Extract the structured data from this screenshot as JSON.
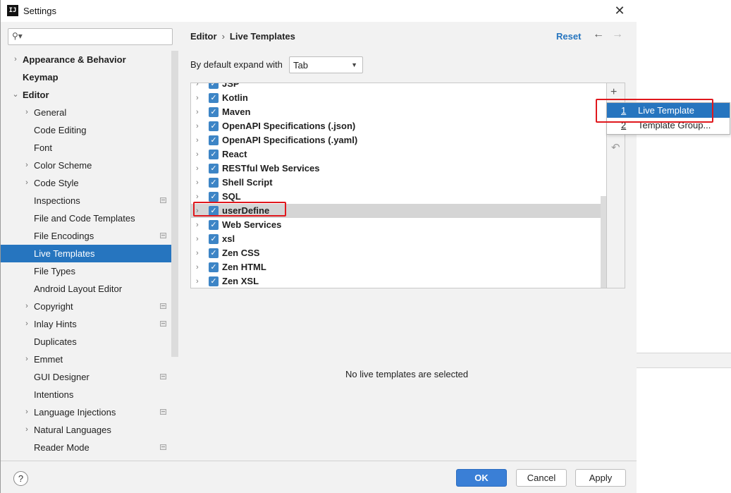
{
  "window": {
    "title": "Settings",
    "app_icon_text": "IJ"
  },
  "search": {
    "placeholder": ""
  },
  "sidebar": {
    "items": [
      {
        "label": "Appearance & Behavior",
        "bold": true,
        "level": 0,
        "chevron": "›"
      },
      {
        "label": "Keymap",
        "bold": true,
        "level": 0,
        "chevron": ""
      },
      {
        "label": "Editor",
        "bold": true,
        "level": 0,
        "chevron": "⌄"
      },
      {
        "label": "General",
        "level": 1,
        "chevron": "›"
      },
      {
        "label": "Code Editing",
        "level": 1,
        "chevron": ""
      },
      {
        "label": "Font",
        "level": 1,
        "chevron": ""
      },
      {
        "label": "Color Scheme",
        "level": 1,
        "chevron": "›"
      },
      {
        "label": "Code Style",
        "level": 1,
        "chevron": "›"
      },
      {
        "label": "Inspections",
        "level": 1,
        "chevron": "",
        "project": true
      },
      {
        "label": "File and Code Templates",
        "level": 1,
        "chevron": ""
      },
      {
        "label": "File Encodings",
        "level": 1,
        "chevron": "",
        "project": true
      },
      {
        "label": "Live Templates",
        "level": 1,
        "chevron": "",
        "selected": true
      },
      {
        "label": "File Types",
        "level": 1,
        "chevron": ""
      },
      {
        "label": "Android Layout Editor",
        "level": 1,
        "chevron": ""
      },
      {
        "label": "Copyright",
        "level": 1,
        "chevron": "›",
        "project": true
      },
      {
        "label": "Inlay Hints",
        "level": 1,
        "chevron": "›",
        "project": true
      },
      {
        "label": "Duplicates",
        "level": 1,
        "chevron": ""
      },
      {
        "label": "Emmet",
        "level": 1,
        "chevron": "›"
      },
      {
        "label": "GUI Designer",
        "level": 1,
        "chevron": "",
        "project": true
      },
      {
        "label": "Intentions",
        "level": 1,
        "chevron": ""
      },
      {
        "label": "Language Injections",
        "level": 1,
        "chevron": "›",
        "project": true
      },
      {
        "label": "Natural Languages",
        "level": 1,
        "chevron": "›"
      },
      {
        "label": "Reader Mode",
        "level": 1,
        "chevron": "",
        "project": true
      }
    ]
  },
  "header": {
    "breadcrumb_parent": "Editor",
    "breadcrumb_sep": "›",
    "breadcrumb_current": "Live Templates",
    "reset": "Reset",
    "back_icon": "←",
    "forward_icon": "→"
  },
  "expand": {
    "label": "By default expand with",
    "value": "Tab"
  },
  "templates": {
    "groups": [
      {
        "name": "JSP"
      },
      {
        "name": "Kotlin"
      },
      {
        "name": "Maven"
      },
      {
        "name": "OpenAPI Specifications (.json)"
      },
      {
        "name": "OpenAPI Specifications (.yaml)"
      },
      {
        "name": "React"
      },
      {
        "name": "RESTful Web Services"
      },
      {
        "name": "Shell Script"
      },
      {
        "name": "SQL"
      },
      {
        "name": "userDefine",
        "selected": true
      },
      {
        "name": "Web Services"
      },
      {
        "name": "xsl"
      },
      {
        "name": "Zen CSS"
      },
      {
        "name": "Zen HTML"
      },
      {
        "name": "Zen XSL"
      }
    ],
    "empty_message": "No live templates are selected"
  },
  "toolbar": {
    "add_icon": "+",
    "undo_icon": "↶"
  },
  "popup": {
    "items": [
      {
        "num": "1",
        "label": "Live Template",
        "active": true
      },
      {
        "num": "2",
        "label": "Template Group..."
      }
    ]
  },
  "footer": {
    "help": "?",
    "ok": "OK",
    "cancel": "Cancel",
    "apply": "Apply"
  },
  "colors": {
    "accent": "#2675bf",
    "highlight": "#e0181d",
    "checkbox": "#3d85c6"
  }
}
